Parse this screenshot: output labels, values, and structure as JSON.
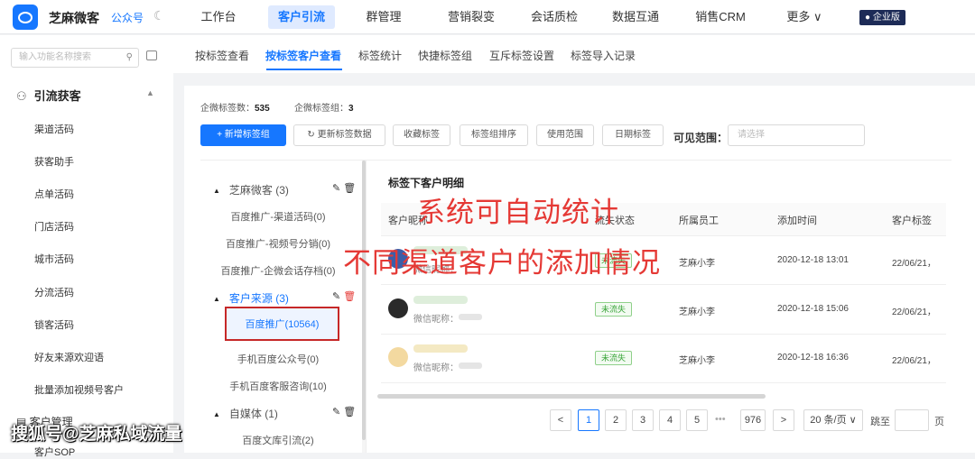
{
  "app": {
    "brand": "芝麻微客",
    "account_label": "公众号",
    "edition": "企业版"
  },
  "topnav": [
    {
      "label": "工作台"
    },
    {
      "label": "客户引流"
    },
    {
      "label": "群管理"
    },
    {
      "label": "营销裂变"
    },
    {
      "label": "会话质检"
    },
    {
      "label": "数据互通"
    },
    {
      "label": "销售CRM"
    },
    {
      "label": "更多 ∨"
    }
  ],
  "sidebar": {
    "search_placeholder": "输入功能名称搜索",
    "group_title": "引流获客",
    "items": [
      {
        "label": "渠道活码"
      },
      {
        "label": "获客助手"
      },
      {
        "label": "点单活码"
      },
      {
        "label": "门店活码"
      },
      {
        "label": "城市活码"
      },
      {
        "label": "分流活码"
      },
      {
        "label": "锁客活码"
      },
      {
        "label": "好友来源欢迎语"
      },
      {
        "label": "批量添加视频号客户"
      }
    ],
    "group2_title": "客户管理",
    "group2_item": "客户SOP"
  },
  "subnav": [
    {
      "label": "按标签查看"
    },
    {
      "label": "按标签客户查看"
    },
    {
      "label": "标签统计"
    },
    {
      "label": "快捷标签组"
    },
    {
      "label": "互斥标签设置"
    },
    {
      "label": "标签导入记录"
    }
  ],
  "stats": {
    "tag_count_label": "企微标签数：",
    "tag_count": "535",
    "group_count_label": "企微标签组：",
    "group_count": "3"
  },
  "toolbar": {
    "add_group": "+ 新增标签组",
    "refresh": "更新标签数据",
    "collect": "收藏标签",
    "sort": "标签组排序",
    "scope": "使用范围",
    "date_tag": "日期标签",
    "visible_label": "可见范围：",
    "visible_placeholder": "请选择"
  },
  "tree": {
    "groups": [
      {
        "label": "芝麻微客 (3)",
        "items": [
          "百度推广-渠道活码(0)",
          "百度推广-视频号分销(0)",
          "百度推广-企微会话存档(0)"
        ]
      },
      {
        "label": "客户来源 (3)",
        "items": [
          "百度推广(10564)",
          "手机百度公众号(0)",
          "手机百度客服咨询(10)"
        ]
      },
      {
        "label": "自媒体 (1)",
        "items": [
          "百度文库引流(2)"
        ]
      }
    ]
  },
  "detail": {
    "title": "标签下客户明细",
    "columns": [
      "客户昵称",
      "流失状态",
      "所属员工",
      "添加时间",
      "客户标签"
    ],
    "rows": [
      {
        "wx_label": "微信昵称：",
        "status": "未流失",
        "staff": "芝麻小李",
        "time": "2020-12-18 13:01",
        "tags": "22/06/21，"
      },
      {
        "wx_label": "微信昵称：",
        "status": "未流失",
        "staff": "芝麻小李",
        "time": "2020-12-18 15:06",
        "tags": "22/06/21，"
      },
      {
        "wx_label": "微信昵称：",
        "status": "未流失",
        "staff": "芝麻小李",
        "time": "2020-12-18 16:36",
        "tags": "22/06/21，"
      }
    ]
  },
  "pagination": {
    "prev": "<",
    "pages": [
      "1",
      "2",
      "3",
      "4",
      "5"
    ],
    "ellipsis": "•••",
    "last": "976",
    "next": ">",
    "page_size": "20 条/页 ∨",
    "jump_label": "跳至",
    "page_unit": "页"
  },
  "overlay": {
    "line1": "系统可自动统计",
    "line2": "不同渠道客户的添加情况"
  },
  "watermark": "搜狐号@芝麻私域流量",
  "colors": {
    "primary": "#1677ff",
    "highlight_red": "#e53935",
    "status_green": "#3aa53a"
  }
}
